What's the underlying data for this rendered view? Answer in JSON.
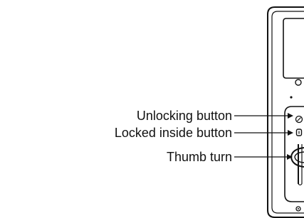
{
  "callouts": [
    {
      "id": "unlocking",
      "label": "Unlocking button"
    },
    {
      "id": "locked-inside",
      "label": "Locked inside button"
    },
    {
      "id": "thumb-turn",
      "label": "Thumb turn"
    }
  ],
  "colors": {
    "line": "#111111",
    "background": "#ffffff"
  }
}
